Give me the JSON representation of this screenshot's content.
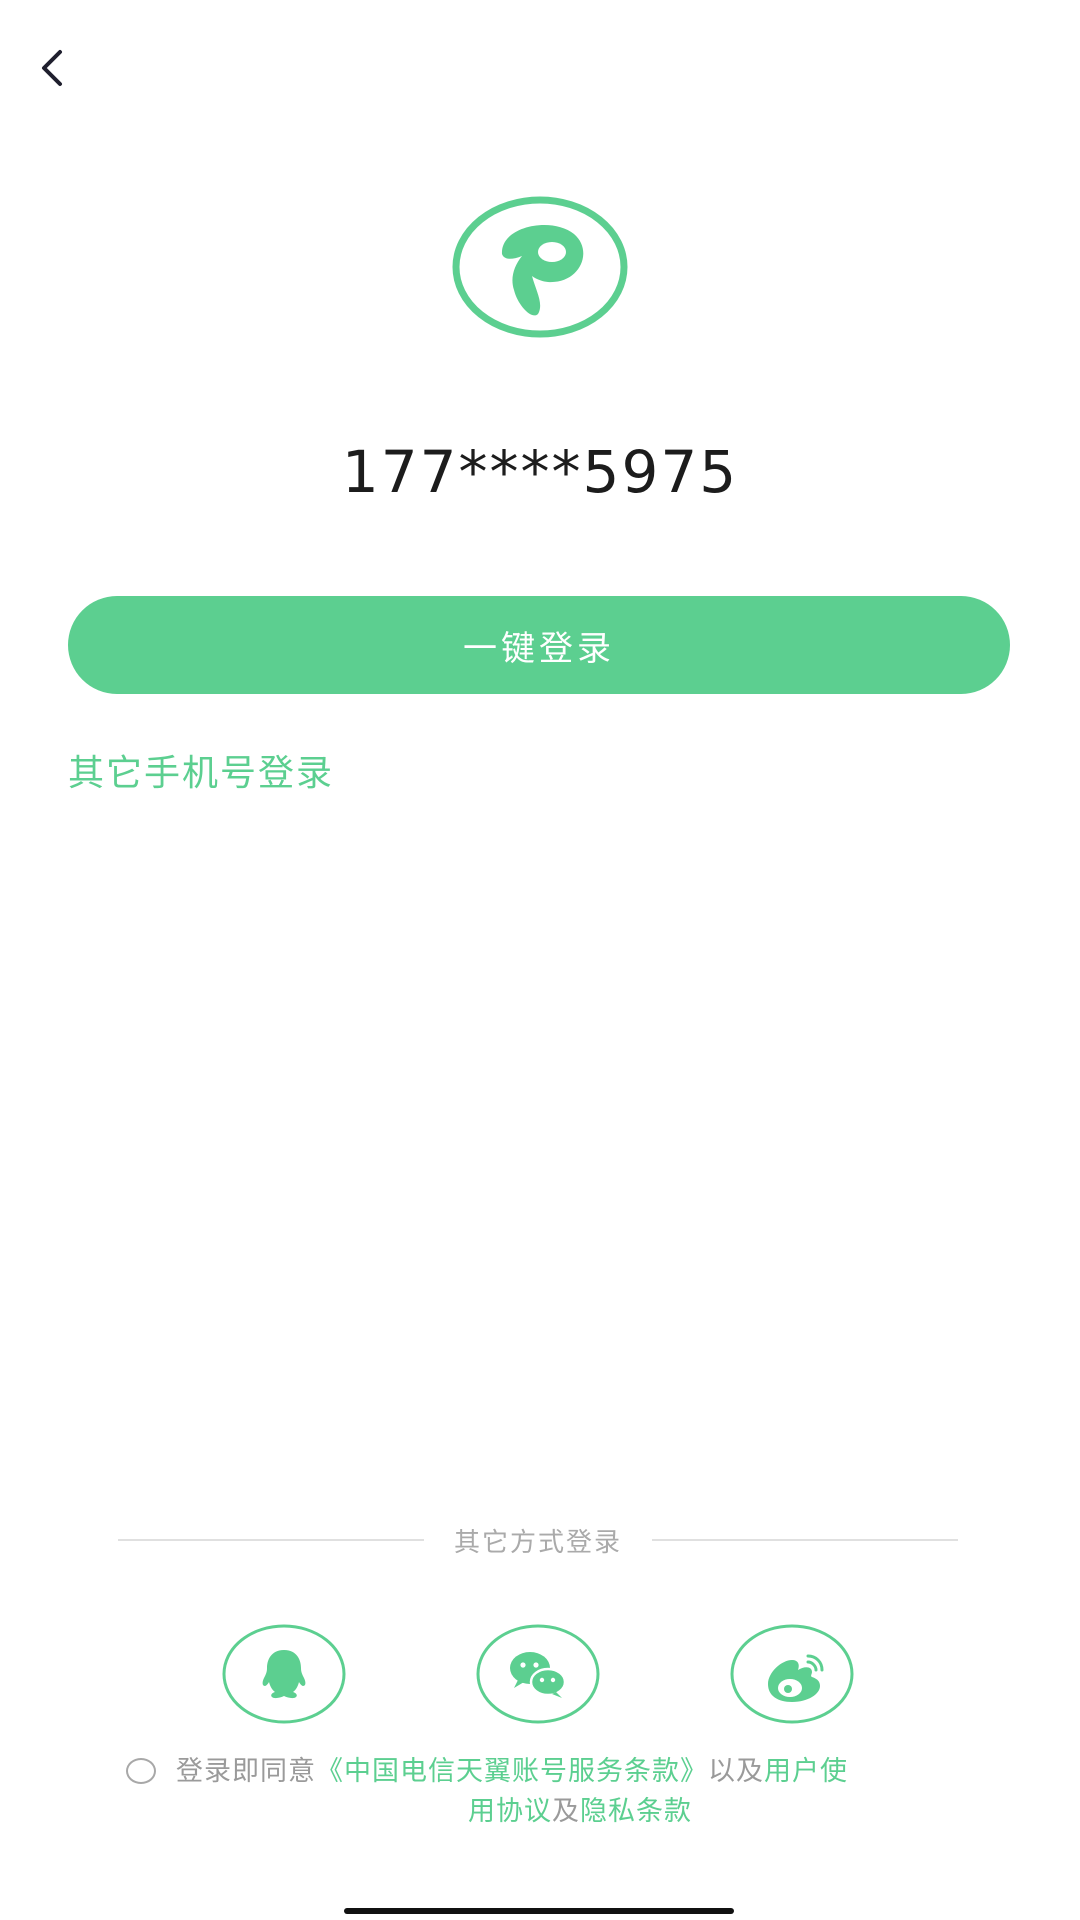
{
  "colors": {
    "accent": "#5ccf90",
    "muted_text": "#9a9a9a",
    "divider": "#e0e0e0"
  },
  "header": {
    "back_icon": "chevron-left-icon"
  },
  "logo": {
    "icon": "app-logo-p-icon"
  },
  "phone": {
    "masked_number": "177****5975"
  },
  "primary": {
    "one_click_login_label": "一键登录",
    "other_phone_login_label": "其它手机号登录"
  },
  "alt_login": {
    "divider_label": "其它方式登录",
    "providers": [
      {
        "name": "qq",
        "icon": "qq-icon"
      },
      {
        "name": "wechat",
        "icon": "wechat-icon"
      },
      {
        "name": "weibo",
        "icon": "weibo-icon"
      }
    ]
  },
  "agreement": {
    "prefix": "登录即同意",
    "terms_link": "《中国电信天翼账号服务条款》",
    "and1": "以及",
    "user_link_part1": "用户使",
    "user_link_part2": "用协议",
    "and2": "及",
    "privacy_link": "隐私条款"
  }
}
